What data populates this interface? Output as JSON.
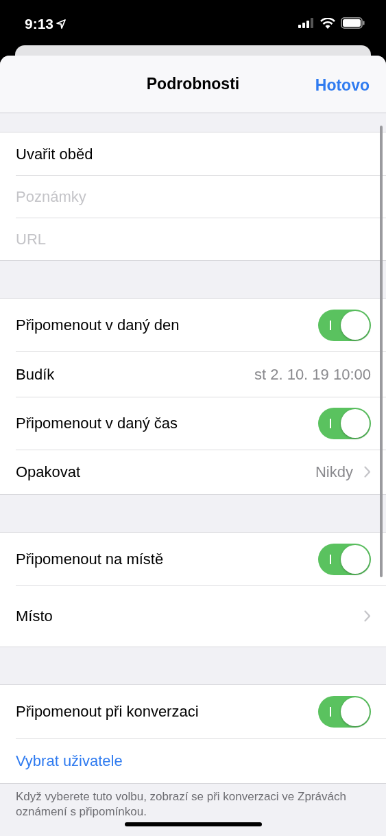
{
  "status_bar": {
    "time": "9:13"
  },
  "header": {
    "title": "Podrobnosti",
    "done": "Hotovo"
  },
  "sections": [
    {
      "rows": [
        {
          "kind": "field",
          "value": "Uvařit oběd"
        },
        {
          "kind": "field",
          "placeholder": "Poznámky"
        },
        {
          "kind": "field",
          "placeholder": "URL"
        }
      ]
    },
    {
      "rows": [
        {
          "kind": "toggle",
          "label": "Připomenout v daný den",
          "on": true
        },
        {
          "kind": "value",
          "label": "Budík",
          "value": "st 2. 10. 19 10:00"
        },
        {
          "kind": "toggle",
          "label": "Připomenout v daný čas",
          "on": true
        },
        {
          "kind": "nav",
          "label": "Opakovat",
          "value": "Nikdy"
        }
      ]
    },
    {
      "rows": [
        {
          "kind": "toggle",
          "label": "Připomenout na místě",
          "on": true
        },
        {
          "kind": "nav",
          "label": "Místo"
        }
      ]
    },
    {
      "rows": [
        {
          "kind": "toggle",
          "label": "Připomenout při konverzaci",
          "on": true
        },
        {
          "kind": "link",
          "label": "Vybrat uživatele"
        }
      ],
      "footer": "Když vyberete tuto volbu, zobrazí se při konverzaci ve Zprávách oznámení s připomínkou."
    }
  ]
}
